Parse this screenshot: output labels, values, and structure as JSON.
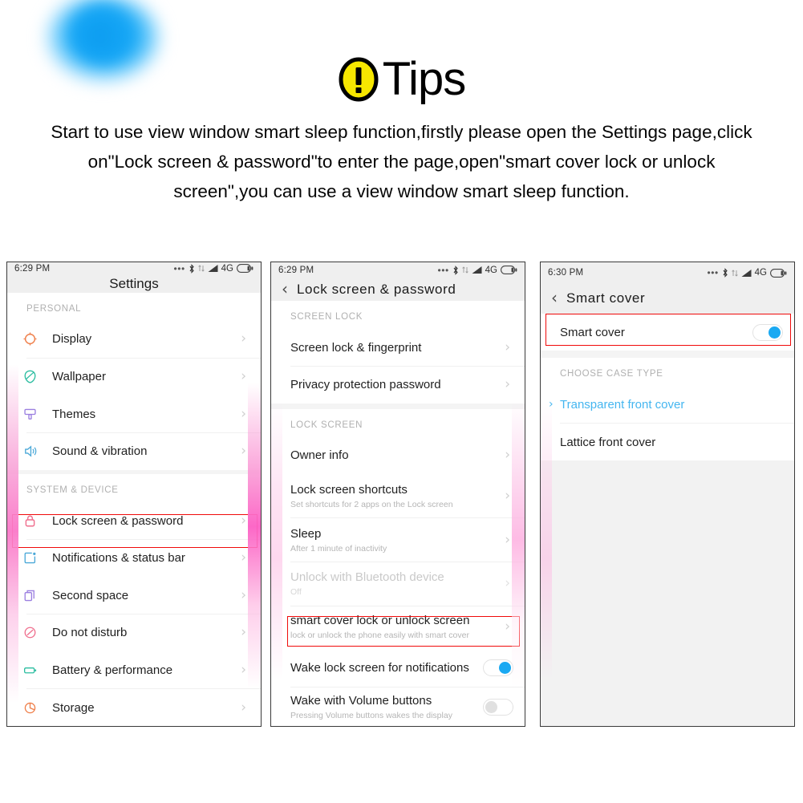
{
  "header": {
    "icon": "warning-exclamation-icon",
    "title": "Tips",
    "body": "Start to use view window smart sleep function,firstly please open the Settings page,click on\"Lock screen & password\"to enter the page,open\"smart cover lock or unlock screen\",you can use a view window smart sleep function."
  },
  "colors": {
    "accent_blue": "#1aa9f2",
    "highlight_red": "#f00a0a",
    "warn_yellow": "#f7e700",
    "link_blue": "#45b6f0",
    "statusbar_bg": "#efefef"
  },
  "panels": [
    {
      "name": "settings-screen",
      "statusbar": {
        "time": "6:29 PM",
        "dots": "•••",
        "bluetooth": "bluetooth-icon",
        "vpn": "vpn-icon",
        "signal": "signal-bars-icon",
        "network": "4G",
        "battery": "battery-icon"
      },
      "appbar": {
        "title": "Settings",
        "has_back": false
      },
      "sections": [
        {
          "header": "PERSONAL",
          "rows": [
            {
              "icon": "display-icon",
              "icon_color": "#ef7f4a",
              "title": "Display",
              "subtitle": "",
              "chevron": true
            },
            {
              "icon": "wallpaper-icon",
              "icon_color": "#2bbda0",
              "title": "Wallpaper",
              "subtitle": "",
              "chevron": true
            },
            {
              "icon": "themes-icon",
              "icon_color": "#9b7fe0",
              "title": "Themes",
              "subtitle": "",
              "chevron": true
            },
            {
              "icon": "sound-vibration-icon",
              "icon_color": "#4aa8d8",
              "title": "Sound & vibration",
              "subtitle": "",
              "chevron": true
            }
          ]
        },
        {
          "header": "SYSTEM & DEVICE",
          "rows": [
            {
              "icon": "lock-icon",
              "icon_color": "#ef6f8e",
              "title": "Lock screen & password",
              "subtitle": "",
              "chevron": true,
              "highlighted": true
            },
            {
              "icon": "notifications-statusbar-icon",
              "icon_color": "#4aa8d8",
              "title": "Notifications & status bar",
              "subtitle": "",
              "chevron": true
            },
            {
              "icon": "second-space-icon",
              "icon_color": "#9b7fe0",
              "title": "Second space",
              "subtitle": "",
              "chevron": true
            },
            {
              "icon": "do-not-disturb-icon",
              "icon_color": "#ef6f8e",
              "title": "Do not disturb",
              "subtitle": "",
              "chevron": true
            },
            {
              "icon": "battery-performance-icon",
              "icon_color": "#2bbda0",
              "title": "Battery & performance",
              "subtitle": "",
              "chevron": true
            },
            {
              "icon": "storage-icon",
              "icon_color": "#ef7f4a",
              "title": "Storage",
              "subtitle": "",
              "chevron": true
            }
          ]
        }
      ]
    },
    {
      "name": "lock-screen-password-screen",
      "statusbar": {
        "time": "6:29 PM",
        "dots": "•••",
        "network": "4G"
      },
      "appbar": {
        "title": "Lock  screen  &  password",
        "has_back": true,
        "back": "‹"
      },
      "sections": [
        {
          "header": "SCREEN LOCK",
          "rows": [
            {
              "title": "Screen lock & fingerprint",
              "subtitle": "",
              "chevron": true
            },
            {
              "title": "Privacy protection password",
              "subtitle": "",
              "chevron": true
            }
          ]
        },
        {
          "header": "LOCK SCREEN",
          "rows": [
            {
              "title": "Owner info",
              "subtitle": "",
              "chevron": true
            },
            {
              "title": "Lock screen shortcuts",
              "subtitle": "Set shortcuts for 2 apps on the Lock screen",
              "chevron": true
            },
            {
              "title": "Sleep",
              "subtitle": "After 1 minute of inactivity",
              "chevron": true
            },
            {
              "title": "Unlock with Bluetooth device",
              "subtitle": "Off",
              "chevron": true,
              "disabled": true
            },
            {
              "title": "smart cover lock or unlock screen",
              "subtitle": "lock or unlock the phone easily with smart cover",
              "chevron": true,
              "highlighted": true
            },
            {
              "title": "Wake lock screen for notifications",
              "subtitle": "",
              "toggle": "on"
            },
            {
              "title": "Wake with Volume buttons",
              "subtitle": "Pressing Volume buttons wakes the display",
              "toggle": "off"
            }
          ]
        }
      ]
    },
    {
      "name": "smart-cover-screen",
      "statusbar": {
        "time": "6:30 PM",
        "dots": "•••",
        "network": "4G"
      },
      "appbar": {
        "title": "Smart  cover",
        "has_back": true,
        "back": "‹"
      },
      "sections": [
        {
          "header": "",
          "rows": [
            {
              "title": "Smart cover",
              "subtitle": "",
              "toggle": "on",
              "highlighted": true
            }
          ]
        },
        {
          "header": "CHOOSE CASE TYPE",
          "rows": [
            {
              "title": "Transparent front cover",
              "subtitle": "",
              "selected": true,
              "left_chevron": "›"
            },
            {
              "title": "Lattice front cover",
              "subtitle": ""
            }
          ]
        }
      ]
    }
  ]
}
